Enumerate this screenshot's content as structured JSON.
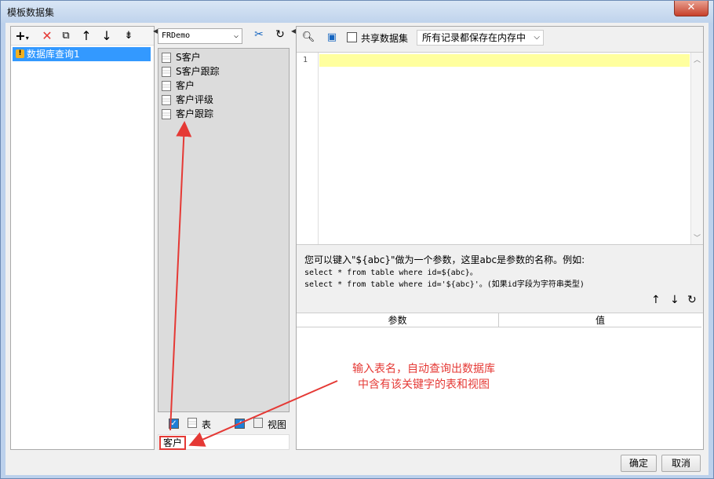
{
  "window": {
    "title": "模板数据集"
  },
  "left": {
    "tree_item": "数据库查询1"
  },
  "middle": {
    "datasource": "FRDemo",
    "tables": [
      "S客户",
      "S客户跟踪",
      "客户",
      "客户评级",
      "客户跟踪"
    ],
    "filter_table_label": "表",
    "filter_view_label": "视图",
    "search_value": "客户"
  },
  "right": {
    "share_label": "共享数据集",
    "memory_option": "所有记录都保存在内存中",
    "line_number": "1",
    "hint_line1": "您可以键入\"${abc}\"做为一个参数，这里abc是参数的名称。例如:",
    "hint_line2": "select * from table where id=${abc}。",
    "hint_line3": "select * from table where id='${abc}'。(如果id字段为字符串类型)",
    "param_col": "参数",
    "value_col": "值"
  },
  "buttons": {
    "ok": "确定",
    "cancel": "取消"
  },
  "annotation": {
    "line1": "输入表名，自动查询出数据库",
    "line2": "中含有该关键字的表和视图"
  },
  "colors": {
    "highlight": "#e53935",
    "selection": "#3399ff"
  }
}
